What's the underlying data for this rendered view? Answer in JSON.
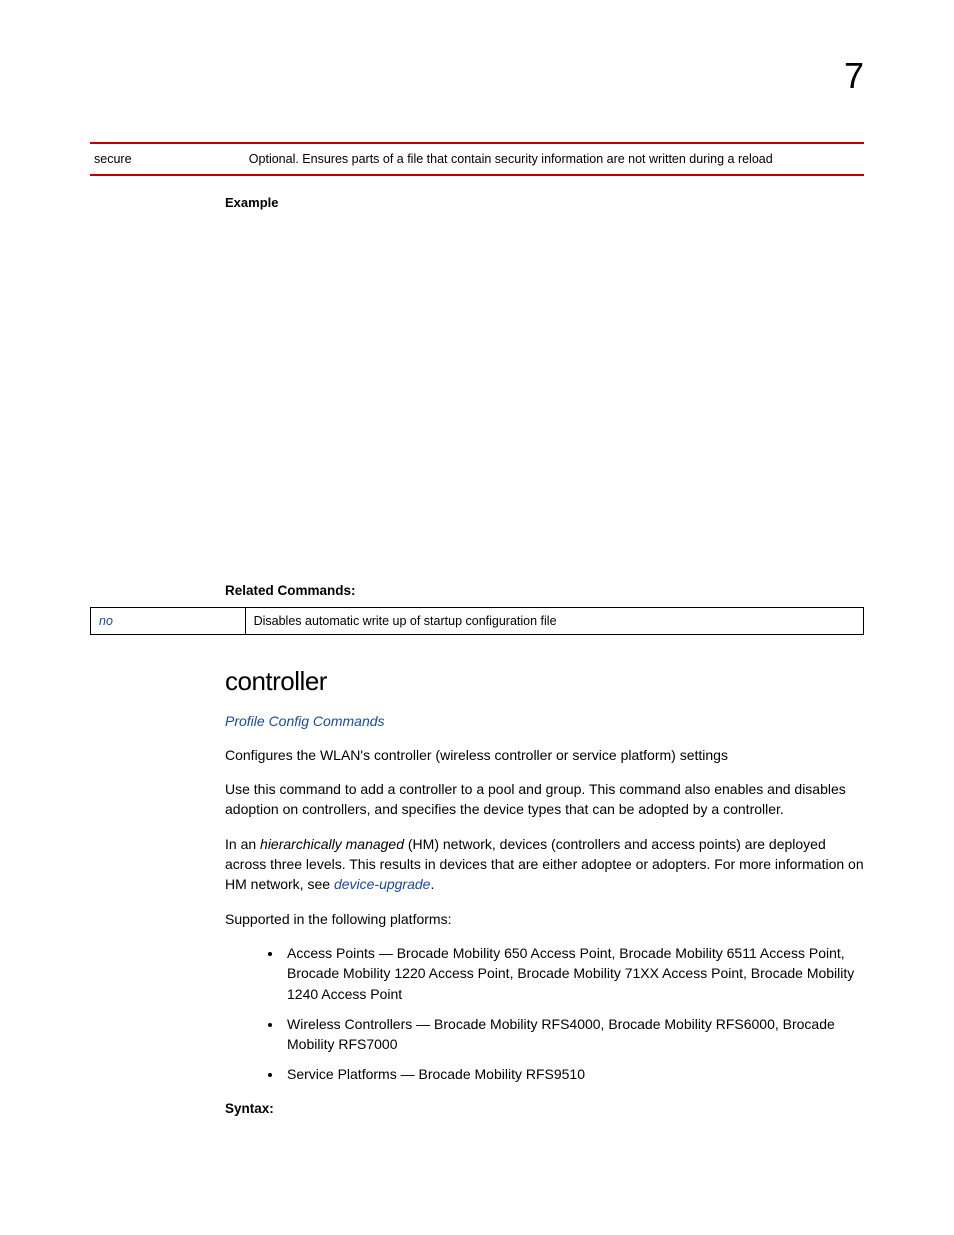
{
  "chapter_number": "7",
  "param_table": {
    "name": "secure",
    "desc": "Optional. Ensures parts of a file that contain security information are not written during a reload"
  },
  "example_label": "Example",
  "related_label": "Related Commands:",
  "related_table": {
    "cmd": "no",
    "desc": "Disables automatic write up of startup configuration file"
  },
  "controller": {
    "heading": "controller",
    "breadcrumb": "Profile Config Commands",
    "para1": "Configures the WLAN's controller (wireless controller or service platform) settings",
    "para2": "Use this command to add a controller to a pool and group. This command also enables and disables adoption on controllers, and specifies the device types that can be adopted by a controller.",
    "para3_a": "In an ",
    "para3_em": "hierarchically managed",
    "para3_b": " (HM) network, devices (controllers and access points) are deployed across three levels. This results in devices that are either adoptee or adopters. For more information on HM network, see ",
    "para3_link": "device-upgrade",
    "para3_c": ".",
    "supported_line": "Supported in the following platforms:",
    "bullets": [
      "Access Points — Brocade Mobility 650 Access Point, Brocade Mobility 6511 Access Point, Brocade Mobility 1220 Access Point, Brocade Mobility 71XX Access Point, Brocade Mobility 1240 Access Point",
      "Wireless Controllers — Brocade Mobility RFS4000, Brocade Mobility RFS6000, Brocade Mobility RFS7000",
      "Service Platforms — Brocade Mobility RFS9510"
    ],
    "syntax_label": "Syntax:"
  }
}
